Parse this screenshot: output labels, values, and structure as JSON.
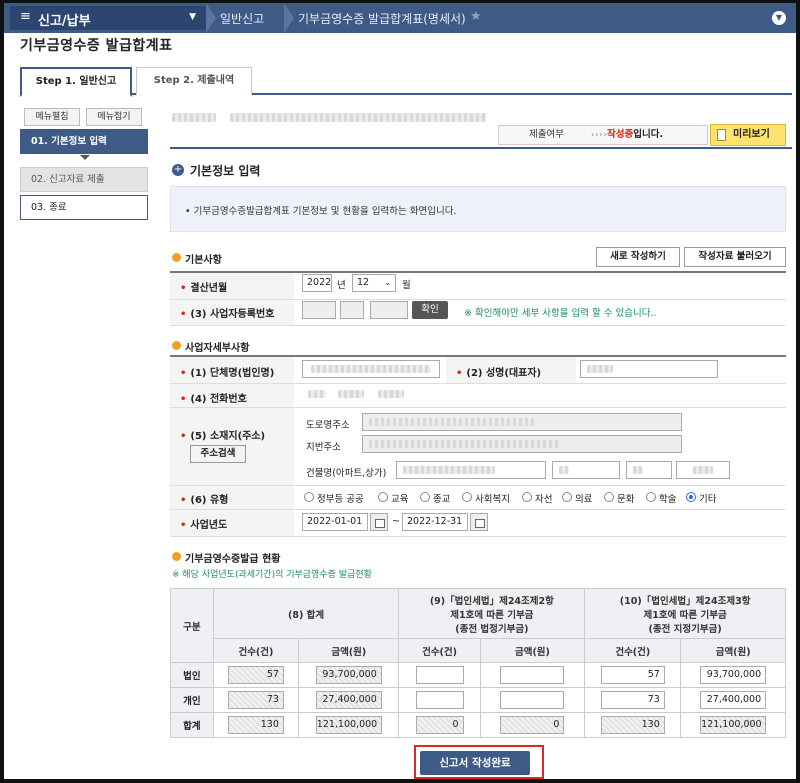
{
  "topbar": {
    "menu_title": "신고/납부",
    "crumbs": [
      "일반신고",
      "기부금영수증 발급합계표(명세서)"
    ]
  },
  "page_title": "기부금영수증 발급합계표",
  "tabs": [
    "Step 1. 일반신고",
    "Step 2. 제출내역"
  ],
  "sidebar": {
    "expand_label": "메뉴펼침",
    "collapse_label": "메뉴접기",
    "items": [
      "01. 기본정보 입력",
      "02. 신고자료 제출",
      "03. 종료"
    ]
  },
  "status": {
    "label": "제출여부",
    "arrows": "››››",
    "value_prefix": "작성중",
    "value_suffix": "입니다.",
    "preview": "미리보기"
  },
  "section_title": "기본정보 입력",
  "info_text": "• 기부금영수증발급합계표 기본정보 및 현황을 입력하는 화면입니다.",
  "basic": {
    "title": "기본사항",
    "new_btn": "새로 작성하기",
    "load_btn": "작성자료 불러오기",
    "settle_label": "결산년월",
    "year": "2022",
    "year_unit": "년",
    "month": "12",
    "month_unit": "월",
    "bizno_label": "(3) 사업자등록번호",
    "confirm_btn": "확인",
    "confirm_note": "※ 확인해야만 세부 사항을 입력 할 수 있습니다.."
  },
  "detail": {
    "title": "사업자세부사항",
    "org_label": "(1) 단체명(법인명)",
    "rep_label": "(2) 성명(대표자)",
    "phone_label": "(4) 전화번호",
    "addr_label": "(5) 소재지(주소)",
    "addr_search": "주소검색",
    "road_label": "도로명주소",
    "lot_label": "지번주소",
    "bldg_label": "건물명(아파트,상가)",
    "type_label": "(6) 유형",
    "types": [
      "정부등 공공",
      "교육",
      "종교",
      "사회복지",
      "자선",
      "의료",
      "문화",
      "학술",
      "기타"
    ],
    "selected_type": "기타",
    "year_label": "사업년도",
    "start_date": "2022-01-01",
    "tilde": "~",
    "end_date": "2022-12-31"
  },
  "issuance": {
    "title": "기부금영수증발급 현황",
    "note": "※ 해당 사업년도(과세기간)의 기부금영수증 발급현황",
    "col_group": "구분",
    "col8": "(8) 합계",
    "col9": [
      "(9)「법인세법」제24조제2항",
      "제1호에 따른 기부금",
      "(종전 법정기부금)"
    ],
    "col10": [
      "(10)「법인세법」제24조제3항",
      "제1호에 따른 기부금",
      "(종전 지정기부금)"
    ],
    "count_label": "건수(건)",
    "amount_label": "금액(원)",
    "rows": [
      {
        "label": "법인",
        "c8": "57",
        "a8": "93,700,000",
        "c9": "",
        "a9": "",
        "c10": "57",
        "a10": "93,700,000"
      },
      {
        "label": "개인",
        "c8": "73",
        "a8": "27,400,000",
        "c9": "",
        "a9": "",
        "c10": "73",
        "a10": "27,400,000"
      },
      {
        "label": "합계",
        "c8": "130",
        "a8": "121,100,000",
        "c9": "0",
        "a9": "0",
        "c10": "130",
        "a10": "121,100,000"
      }
    ]
  },
  "submit_label": "신고서 작성완료",
  "colors": {
    "primary": "#3e5a86",
    "accent": "#f0a020",
    "required": "#dd2211",
    "highlight_outline": "#e0262b"
  }
}
